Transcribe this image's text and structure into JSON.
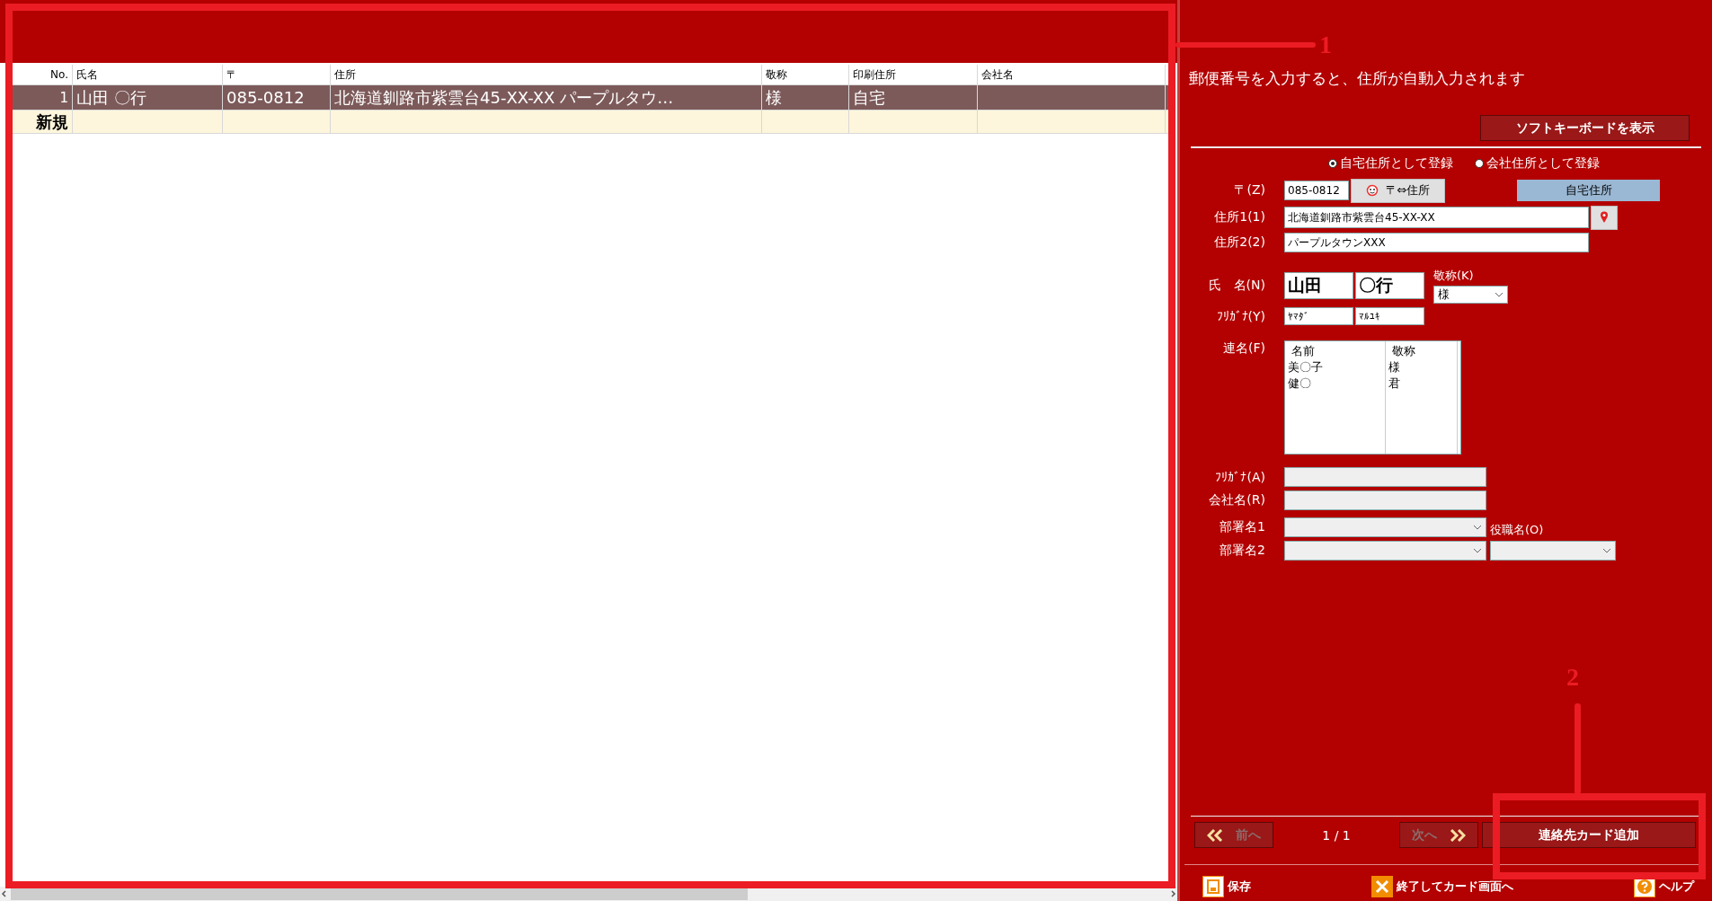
{
  "table": {
    "columns": [
      "No.",
      "氏名",
      "〒",
      "住所",
      "敬称",
      "印刷住所",
      "会社名"
    ],
    "rows": [
      {
        "cells": [
          "1",
          "山田 〇行",
          "085-0812",
          "北海道釧路市紫雲台45-XX-XX パープルタウ…",
          "様",
          "自宅",
          ""
        ],
        "selected": true
      }
    ],
    "new_row": {
      "label": "新規"
    }
  },
  "form": {
    "hint": "郵便番号を入力すると、住所が自動入力されます",
    "soft_keyboard_button": "ソフトキーボードを表示",
    "address_types": [
      {
        "label": "自宅住所として登録",
        "selected": true
      },
      {
        "label": "会社住所として登録",
        "selected": false
      }
    ],
    "postal": {
      "label": "〒(Z)",
      "value": "085-0812",
      "convert_button": "〒⇔住所",
      "address_kind": "自宅住所"
    },
    "address1": {
      "label": "住所1(1)",
      "value": "北海道釧路市紫雲台45-XX-XX"
    },
    "address2": {
      "label": "住所2(2)",
      "value": "パープルタウンXXX"
    },
    "name": {
      "label": "氏　名(N)",
      "last": "山田",
      "first": "〇行",
      "honorific_label": "敬称(K)",
      "honorific": "様"
    },
    "furigana": {
      "label": "ﾌﾘｶﾞﾅ(Y)",
      "last": "ﾔﾏﾀﾞ",
      "first": "ﾏﾙﾕｷ"
    },
    "joint_names": {
      "label": "連名(F)",
      "columns": [
        "名前",
        "敬称"
      ],
      "rows": [
        [
          "美〇子",
          "様"
        ],
        [
          "健〇",
          "君"
        ]
      ]
    },
    "company_furigana": {
      "label": "ﾌﾘｶﾞﾅ(A)",
      "disabled": true
    },
    "company": {
      "label": "会社名(R)",
      "disabled": true
    },
    "department1": {
      "label": "部署名1",
      "disabled": true
    },
    "department2": {
      "label": "部署名2",
      "disabled": true
    },
    "position": {
      "label": "役職名(O)",
      "disabled": true
    },
    "nav": {
      "prev": "前へ",
      "prev_disabled": true,
      "page": "1 / 1",
      "next": "次へ",
      "next_disabled": true,
      "add_button": "連絡先カード追加"
    },
    "footer": [
      {
        "kind": "save",
        "label": "保存"
      },
      {
        "kind": "close",
        "label": "終了してカード画面へ"
      },
      {
        "kind": "help",
        "label": "ヘルプ"
      }
    ]
  },
  "annotations": [
    {
      "label": "1"
    },
    {
      "label": "2"
    }
  ]
}
